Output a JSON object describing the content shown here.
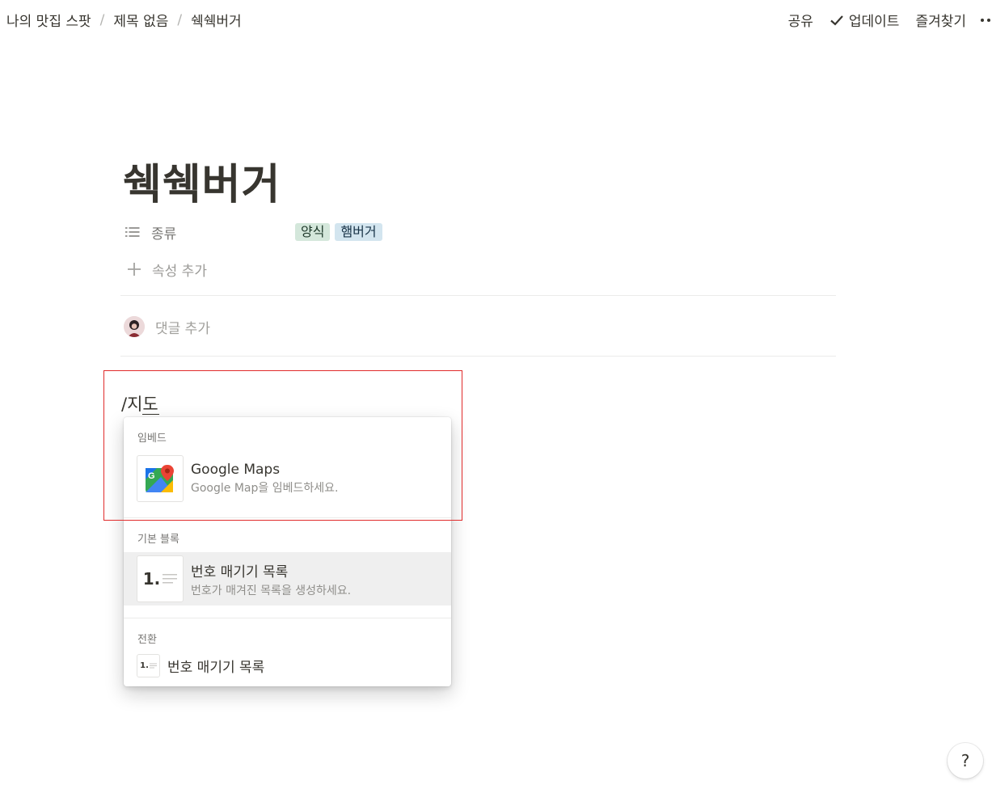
{
  "breadcrumb": {
    "items": [
      "나의 맛집 스팟",
      "제목 없음",
      "쉑쉑버거"
    ],
    "separator": "/"
  },
  "topbar": {
    "share_label": "공유",
    "updates_label": "업데이트",
    "favorite_label": "즐겨찾기",
    "more_icon": "more-dots-icon"
  },
  "page": {
    "title": "쉑쉑버거",
    "property": {
      "name": "종류",
      "icon": "list-icon",
      "tags": [
        {
          "label": "양식",
          "color": "#d4e7db"
        },
        {
          "label": "햄버거",
          "color": "#d3e5ef"
        }
      ]
    },
    "add_property_label": "속성 추가",
    "add_comment_label": "댓글 추가",
    "command": {
      "typed": "/지",
      "composing": "도"
    }
  },
  "slash_menu": {
    "sections": [
      {
        "label": "임베드",
        "items": [
          {
            "title": "Google Maps",
            "description": "Google Map을 임베드하세요.",
            "icon": "google-maps-icon"
          }
        ]
      },
      {
        "label": "기본 블록",
        "items": [
          {
            "title": "번호 매기기 목록",
            "description": "번호가 매겨진 목록을 생성하세요.",
            "icon": "numbered-list-icon",
            "thumb_text": "1."
          }
        ]
      },
      {
        "label": "전환",
        "items": [
          {
            "title": "번호 매기기 목록",
            "icon": "numbered-list-icon",
            "thumb_text": "1."
          }
        ]
      }
    ]
  },
  "help_label": "?",
  "highlight_color": "#e02b2b"
}
